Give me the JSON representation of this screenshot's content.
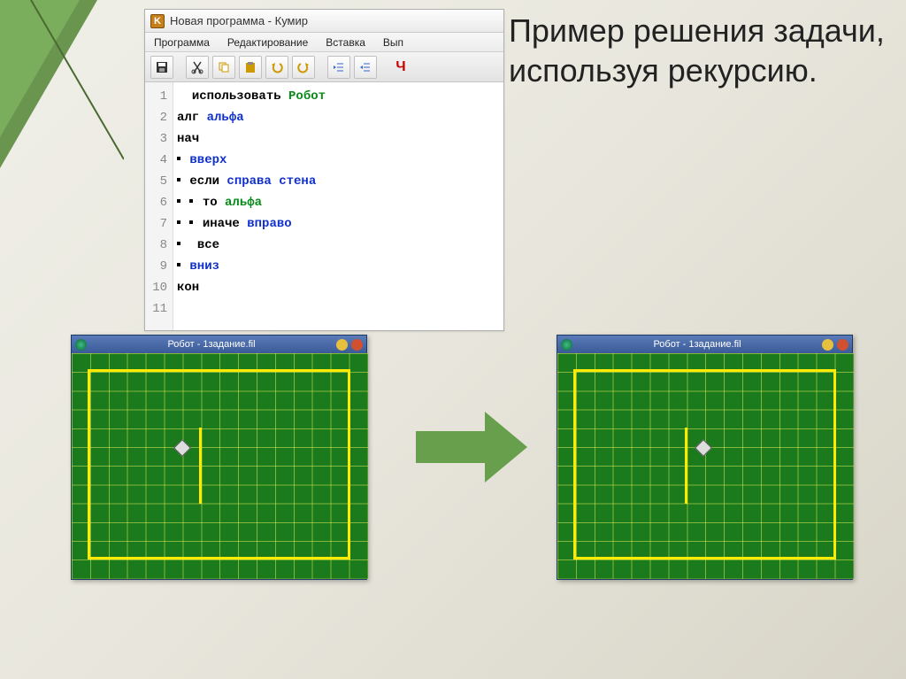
{
  "slide_title": "Пример решения задачи, используя рекурсию.",
  "editor": {
    "title": "Новая программа - Кумир",
    "menu": {
      "m1": "Программа",
      "m2": "Редактирование",
      "m3": "Вставка",
      "m4": "Вып"
    },
    "code": {
      "l1": {
        "a": "использовать ",
        "b": "Робот"
      },
      "l2": {
        "a": "алг ",
        "b": "альфа"
      },
      "l3": {
        "a": "нач"
      },
      "l4": {
        "a": "вверх"
      },
      "l5": {
        "a": "если ",
        "b": "справа стена"
      },
      "l6": {
        "a": "то ",
        "b": "альфа"
      },
      "l7": {
        "a": "иначе ",
        "b": "вправо"
      },
      "l8": {
        "a": "все"
      },
      "l9": {
        "a": "вниз"
      },
      "l10": {
        "a": "кон"
      }
    }
  },
  "robot": {
    "title": "Робот - 1задание.fil"
  }
}
